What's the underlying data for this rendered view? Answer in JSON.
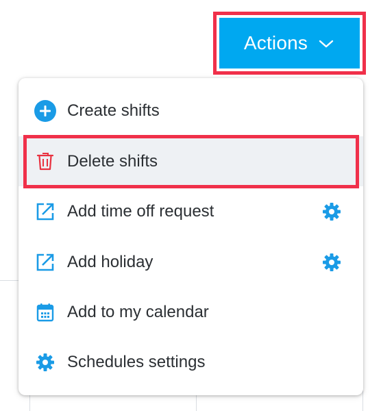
{
  "actions": {
    "label": "Actions",
    "icon": "chevron-down-icon",
    "color": "#00a8f0"
  },
  "menu": {
    "items": [
      {
        "label": "Create shifts",
        "icon": "plus-circle-icon",
        "icon_color": "#1a9be6",
        "has_settings": false
      },
      {
        "label": "Delete shifts",
        "icon": "trash-icon",
        "icon_color": "#e8313f",
        "has_settings": false,
        "highlighted": true
      },
      {
        "label": "Add time off request",
        "icon": "open-external-icon",
        "icon_color": "#1a9be6",
        "has_settings": true
      },
      {
        "label": "Add holiday",
        "icon": "open-external-icon",
        "icon_color": "#1a9be6",
        "has_settings": true
      },
      {
        "label": "Add to my calendar",
        "icon": "calendar-icon",
        "icon_color": "#1a9be6",
        "has_settings": false
      },
      {
        "label": "Schedules settings",
        "icon": "gear-icon",
        "icon_color": "#1a9be6",
        "has_settings": false
      }
    ],
    "settings_icon": "gear-icon"
  },
  "colors": {
    "highlight_outline": "#f0304a",
    "hover_background": "#eef1f4",
    "text": "#2b2f33"
  }
}
